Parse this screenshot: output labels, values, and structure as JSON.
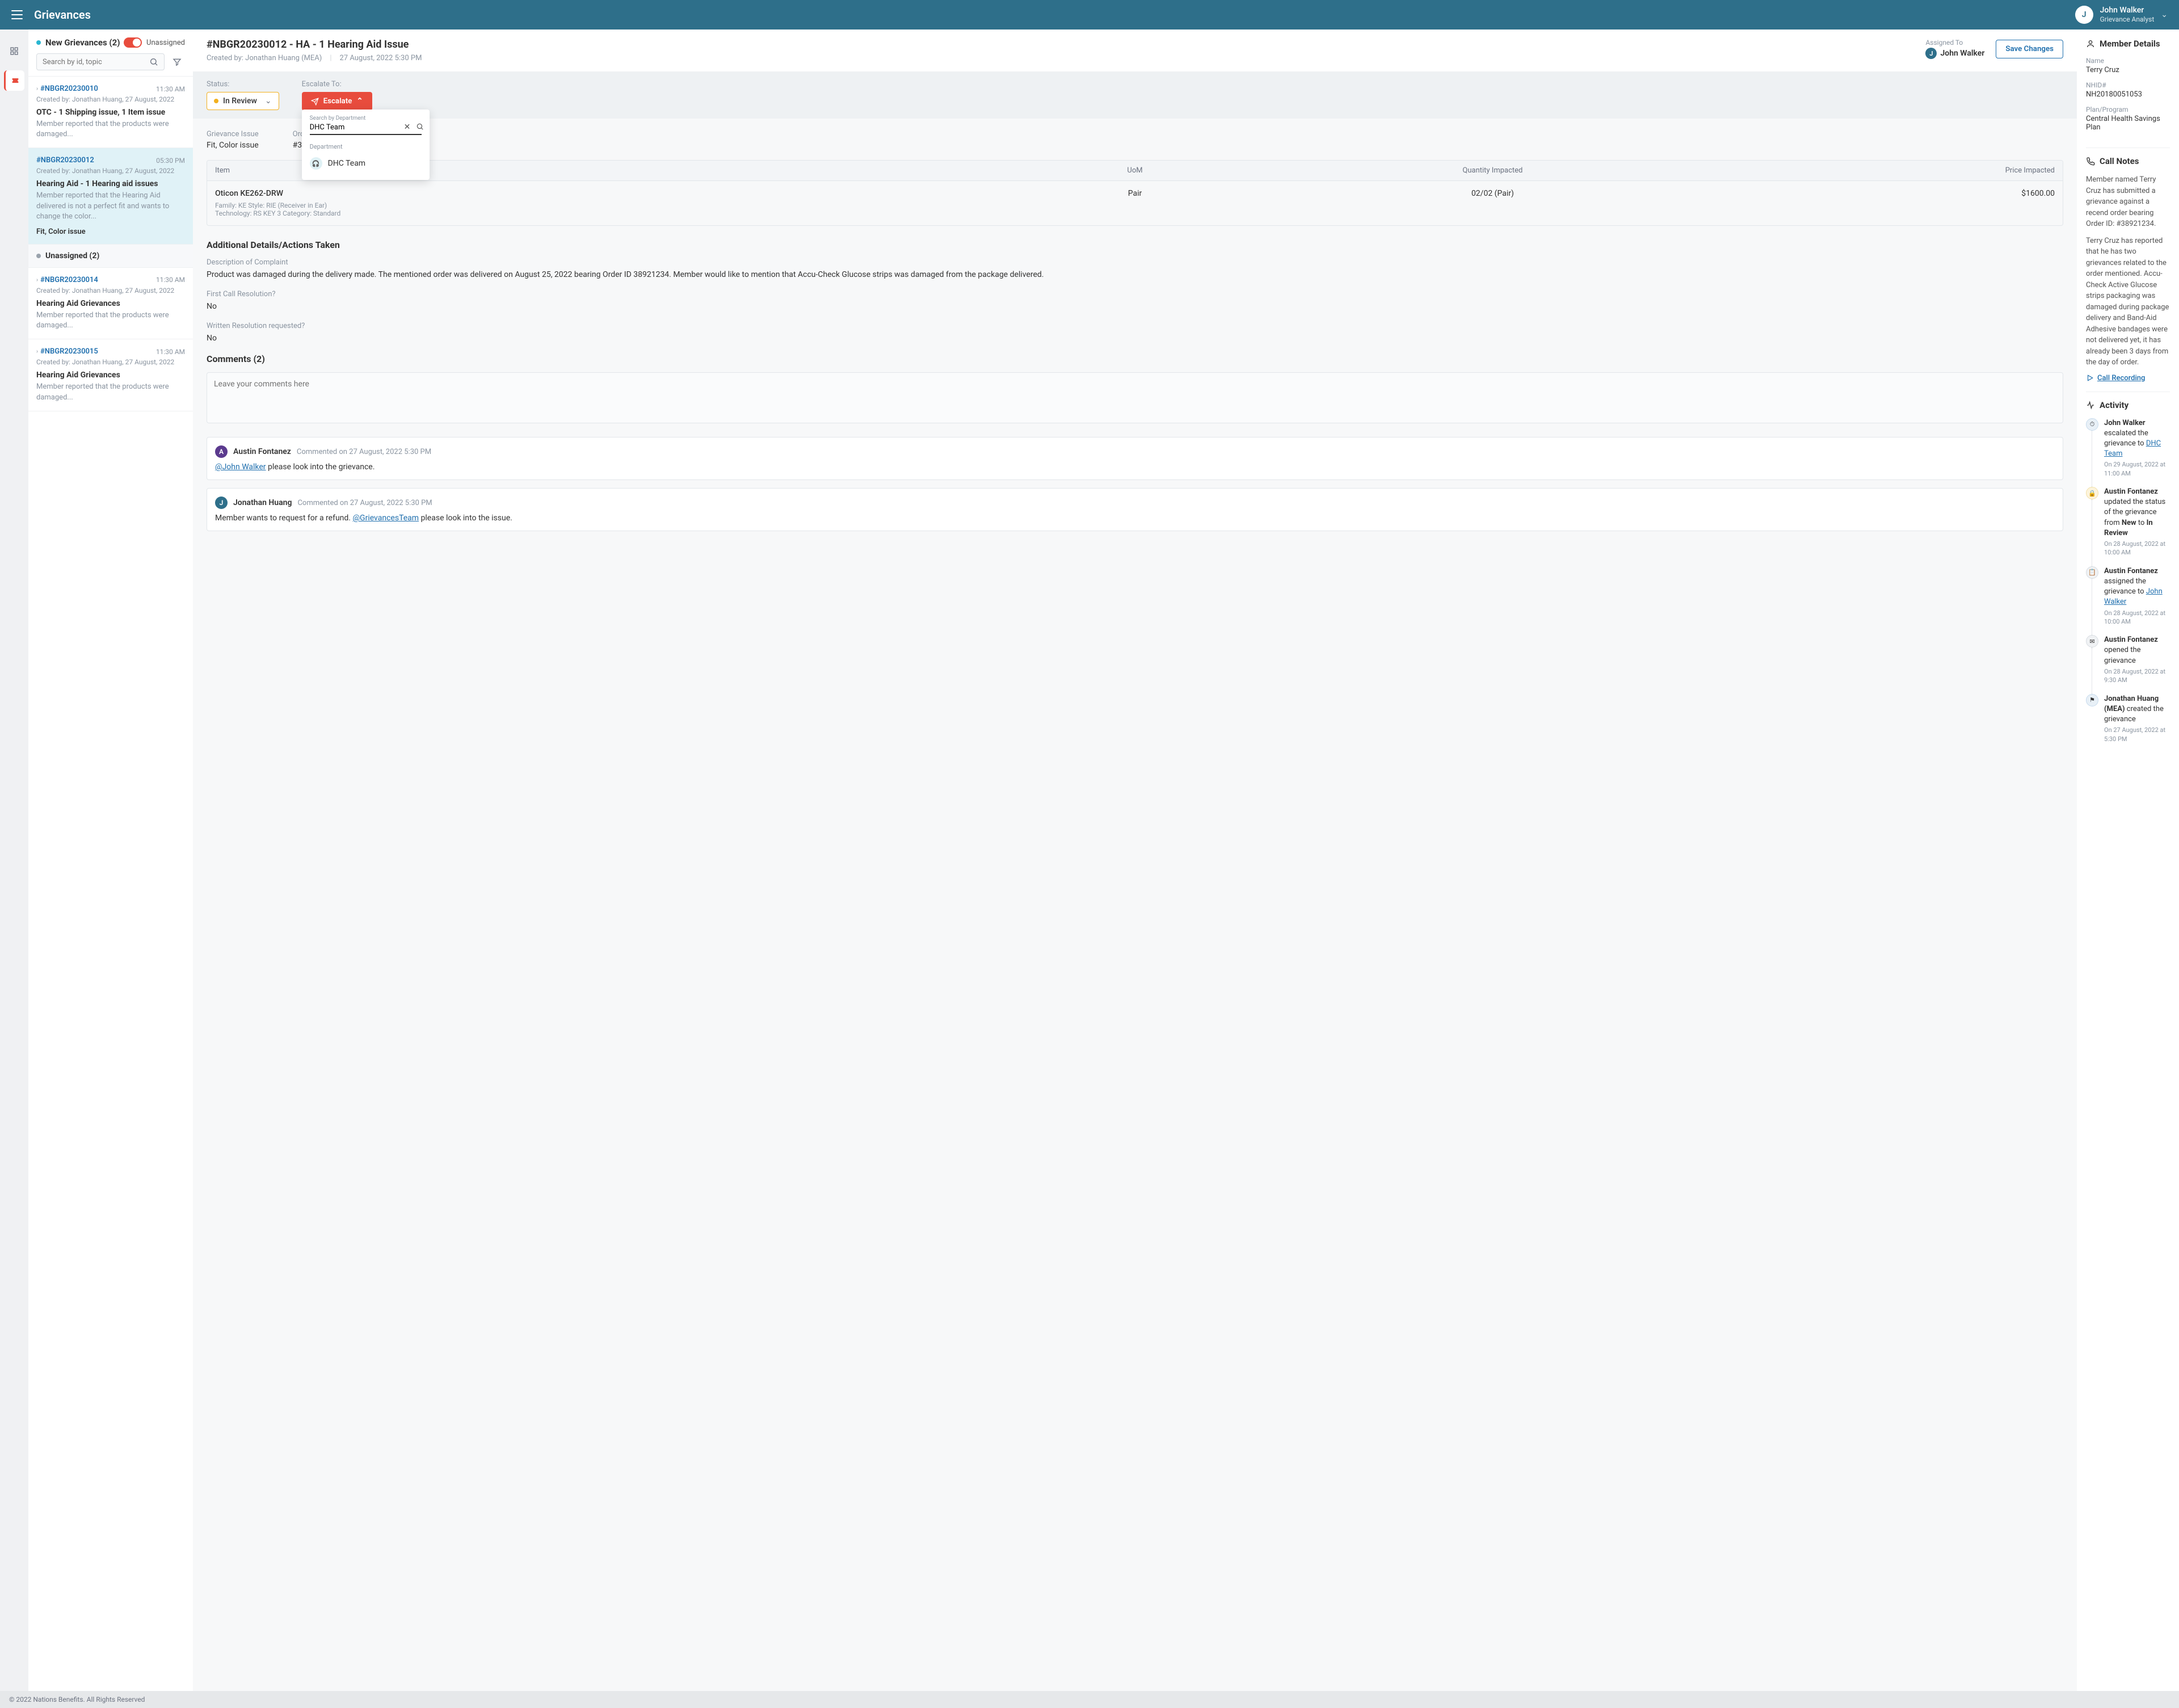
{
  "header": {
    "app_title": "Grievances",
    "user_initial": "J",
    "user_name": "John Walker",
    "user_role": "Grievance Analyst"
  },
  "list": {
    "section1_title": "New Grievances (2)",
    "unassigned_toggle_label": "Unassigned",
    "search_placeholder": "Search by id, topic",
    "items": [
      {
        "id": "#NBGR20230010",
        "time": "11:30 AM",
        "created": "Created by: Jonathan Huang, 27 August, 2022",
        "title": "OTC - 1 Shipping issue, 1 Item issue",
        "desc": "Member reported that the products were damaged..."
      },
      {
        "id": "#NBGR20230012",
        "time": "05:30 PM",
        "created": "Created by: Jonathan Huang, 27 August, 2022",
        "title": "Hearing Aid - 1 Hearing aid issues",
        "desc": "Member reported that the Hearing Aid delivered is not a perfect fit and wants to change the color...",
        "tags": "Fit, Color issue"
      }
    ],
    "section2_title": "Unassigned (2)",
    "items2": [
      {
        "id": "#NBGR20230014",
        "time": "11:30 AM",
        "created": "Created by: Jonathan Huang, 27 August, 2022",
        "title": "Hearing Aid Grievances",
        "desc": "Member reported that the products were damaged..."
      },
      {
        "id": "#NBGR20230015",
        "time": "11:30 AM",
        "created": "Created by: Jonathan Huang, 27 August, 2022",
        "title": "Hearing Aid Grievances",
        "desc": "Member reported that the products were damaged..."
      }
    ]
  },
  "main": {
    "title": "#NBGR20230012 - HA - 1 Hearing Aid Issue",
    "created_by": "Created by: Jonathan Huang (MEA)",
    "created_at": "27 August, 2022  5:30 PM",
    "assigned_label": "Assigned To",
    "assigned_to": "John Walker",
    "assigned_initial": "J",
    "save_btn": "Save Changes",
    "status_label": "Status:",
    "status_value": "In Review",
    "escalate_label": "Escalate To:",
    "escalate_btn": "Escalate",
    "dropdown": {
      "search_label": "Search by Department",
      "search_value": "DHC Team",
      "section_label": "Department",
      "option": "DHC Team"
    },
    "info": {
      "issue_label": "Grievance Issue",
      "issue_value": "Fit, Color issue",
      "order_label": "Order Info",
      "order_value": "#3322144"
    },
    "table": {
      "headers": {
        "item": "Item",
        "uom": "UoM",
        "qty": "Quantity Impacted",
        "price": "Price Impacted"
      },
      "row": {
        "name": "Oticon KE262-DRW",
        "meta1": "Family: KE    Style: RIE (Receiver in Ear)",
        "meta2": "Technology: RS KEY 3    Category: Standard",
        "uom": "Pair",
        "qty": "02/02 (Pair)",
        "price": "$1600.00"
      }
    },
    "details": {
      "heading": "Additional Details/Actions Taken",
      "complaint_label": "Description of Complaint",
      "complaint_text": "Product was damaged during the delivery made. The mentioned order was delivered on August 25, 2022 bearing Order ID 38921234. Member would like to mention that Accu-Check Glucose strips was damaged from the package delivered.",
      "fcr_label": "First Call Resolution?",
      "fcr_value": "No",
      "wr_label": "Written Resolution requested?",
      "wr_value": "No"
    },
    "comments": {
      "heading": "Comments (2)",
      "placeholder": "Leave your comments here",
      "c1": {
        "initial": "A",
        "name": "Austin Fontanez",
        "meta": "Commented on 27 August, 2022  5:30 PM",
        "mention": "@John Walker",
        "text": " please look into the grievance."
      },
      "c2": {
        "initial": "J",
        "name": "Jonathan Huang",
        "meta": "Commented on 27 August, 2022  5:30 PM",
        "pre": "Member wants to request for a refund. ",
        "mention": "@GrievancesTeam",
        "post": " please look into the issue."
      }
    }
  },
  "right": {
    "member_heading": "Member Details",
    "name_label": "Name",
    "name": "Terry Cruz",
    "nhid_label": "NHID#",
    "nhid": "NH20180051053",
    "plan_label": "Plan/Program",
    "plan": "Central Health Savings Plan",
    "notes_heading": "Call Notes",
    "note1": "Member named Terry Cruz has submitted a grievance against a recend order bearing Order ID: #38921234.",
    "note2": "Terry Cruz has reported that he has two grievances related to the order mentioned. Accu-Check Active Glucose strips packaging was damaged during package delivery and Band-Aid Adhesive bandages were not delivered yet, it has already been 3 days from the day of order.",
    "call_recording": "Call Recording",
    "activity_heading": "Activity",
    "activities": [
      {
        "pre": "John Walker",
        "mid": " escalated the grievance to ",
        "link": "DHC Team",
        "time": "On 29 August, 2022 at 11:00 AM"
      },
      {
        "pre": "Austin Fontanez",
        "mid": " updated the status of the grievance from ",
        "b1": "New",
        "mid2": " to ",
        "b2": "In Review",
        "time": "On 28 August, 2022 at 10:00 AM"
      },
      {
        "pre": "Austin Fontanez",
        "mid": " assigned the grievance to ",
        "link": "John Walker",
        "time": "On 28 August, 2022 at 10:00 AM"
      },
      {
        "pre": "Austin Fontanez",
        "mid": " opened the grievance",
        "time": "On 28 August, 2022 at 9:30 AM"
      },
      {
        "pre": "Jonathan Huang (MEA)",
        "mid": " created the grievance",
        "time": "On 27 August, 2022 at 5:30 PM"
      }
    ]
  },
  "footer": "© 2022 Nations Benefits. All Rights Reserved"
}
